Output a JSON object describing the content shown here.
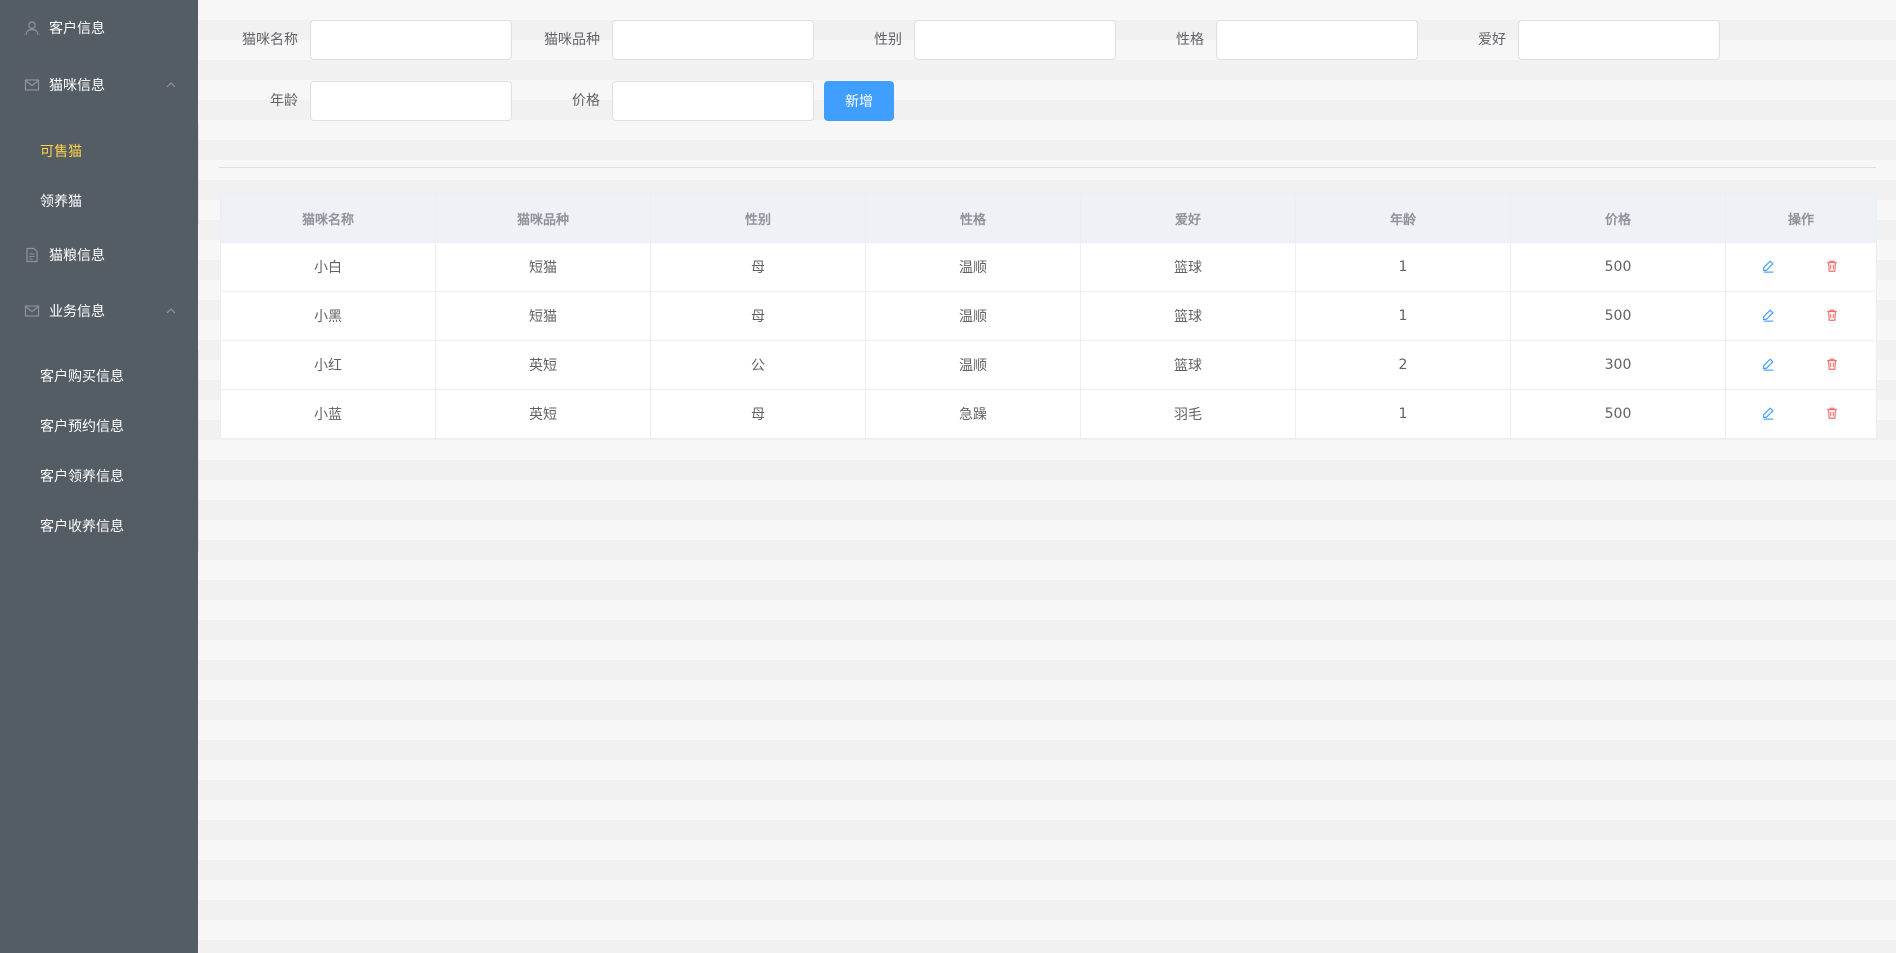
{
  "sidebar": {
    "items": [
      {
        "label": "客户信息",
        "icon": "user-icon"
      },
      {
        "label": "猫咪信息",
        "icon": "mail-icon",
        "expanded": true,
        "children": [
          {
            "label": "可售猫",
            "active": true
          },
          {
            "label": "领养猫"
          }
        ]
      },
      {
        "label": "猫粮信息",
        "icon": "document-icon"
      },
      {
        "label": "业务信息",
        "icon": "mail-icon",
        "expanded": true,
        "children": [
          {
            "label": "客户购买信息"
          },
          {
            "label": "客户预约信息"
          },
          {
            "label": "客户领养信息"
          },
          {
            "label": "客户收养信息"
          }
        ]
      }
    ],
    "active_color": "#ffd04b",
    "background": "#545c64"
  },
  "form": {
    "fields": [
      {
        "label": "猫咪名称",
        "value": ""
      },
      {
        "label": "猫咪品种",
        "value": ""
      },
      {
        "label": "性别",
        "value": ""
      },
      {
        "label": "性格",
        "value": ""
      },
      {
        "label": "爱好",
        "value": ""
      },
      {
        "label": "年龄",
        "value": ""
      },
      {
        "label": "价格",
        "value": ""
      }
    ],
    "add_button": "新增"
  },
  "table": {
    "headers": [
      "猫咪名称",
      "猫咪品种",
      "性别",
      "性格",
      "爱好",
      "年龄",
      "价格",
      "操作"
    ],
    "rows": [
      [
        "小白",
        "短猫",
        "母",
        "温顺",
        "篮球",
        "1",
        "500"
      ],
      [
        "小黑",
        "短猫",
        "母",
        "温顺",
        "篮球",
        "1",
        "500"
      ],
      [
        "小红",
        "英短",
        "公",
        "温顺",
        "篮球",
        "2",
        "300"
      ],
      [
        "小蓝",
        "英短",
        "母",
        "急躁",
        "羽毛",
        "1",
        "500"
      ]
    ],
    "actions": [
      {
        "icon": "edit-icon",
        "color": "#409eff"
      },
      {
        "icon": "delete-icon",
        "color": "#f56c6c"
      }
    ]
  },
  "colors": {
    "primary": "#409eff",
    "danger": "#f56c6c"
  }
}
